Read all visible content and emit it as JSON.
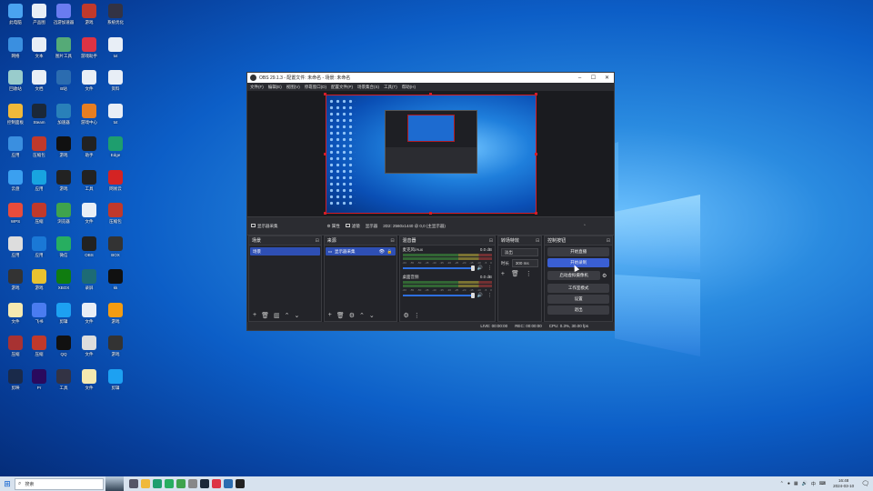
{
  "colors": {
    "accent": "#3a5fd3",
    "selection": "#2e4fb4",
    "preview_border": "#d31d28"
  },
  "desktop": {
    "icons": [
      {
        "label": "此电脑",
        "icon": "computer-icon",
        "color": "#4aa3f0"
      },
      {
        "label": "产品图",
        "icon": "document-icon",
        "color": "#e8eef6"
      },
      {
        "label": "迅游加速器",
        "icon": "app-icon",
        "color": "#6a7cf0"
      },
      {
        "label": "游戏",
        "icon": "winrar-icon",
        "color": "#c0392b"
      },
      {
        "label": "系统优化",
        "icon": "app-icon",
        "color": "#334"
      },
      {
        "label": "网络",
        "icon": "network-icon",
        "color": "#3a8fe0"
      },
      {
        "label": "文本",
        "icon": "document-icon",
        "color": "#e8eef6"
      },
      {
        "label": "图片工具",
        "icon": "app-icon",
        "color": "#5a7"
      },
      {
        "label": "游戏助手",
        "icon": "game-icon",
        "color": "#d34"
      },
      {
        "label": "txt",
        "icon": "document-icon",
        "color": "#e8eef6"
      },
      {
        "label": "回收站",
        "icon": "recycle-bin-icon",
        "color": "#9cc"
      },
      {
        "label": "文档",
        "icon": "document-icon",
        "color": "#e8eef6"
      },
      {
        "label": "B站",
        "icon": "bilibili-icon",
        "color": "#2b6cb0"
      },
      {
        "label": "文件",
        "icon": "document-icon",
        "color": "#e8eef6"
      },
      {
        "label": "资料",
        "icon": "document-icon",
        "color": "#e8eef6"
      },
      {
        "label": "控制面板",
        "icon": "folder-icon",
        "color": "#f0b93a"
      },
      {
        "label": "Steam",
        "icon": "steam-icon",
        "color": "#1b2838"
      },
      {
        "label": "加速器",
        "icon": "vpn-icon",
        "color": "#2980b9"
      },
      {
        "label": "游戏中心",
        "icon": "game-icon",
        "color": "#e67e22"
      },
      {
        "label": "txt",
        "icon": "document-icon",
        "color": "#e8eef6"
      },
      {
        "label": "应用",
        "icon": "app-icon",
        "color": "#3a8fe0"
      },
      {
        "label": "压缩包",
        "icon": "winrar-icon",
        "color": "#c0392b"
      },
      {
        "label": "游戏",
        "icon": "game-icon",
        "color": "#111"
      },
      {
        "label": "助手",
        "icon": "game-icon",
        "color": "#222"
      },
      {
        "label": "Edge",
        "icon": "edge-icon",
        "color": "#1e9e6e"
      },
      {
        "label": "云盘",
        "icon": "cloud-icon",
        "color": "#3ba0f0"
      },
      {
        "label": "应用",
        "icon": "app-icon",
        "color": "#18a4e0"
      },
      {
        "label": "游戏",
        "icon": "game-icon",
        "color": "#222"
      },
      {
        "label": "工具",
        "icon": "app-icon",
        "color": "#222"
      },
      {
        "label": "网易云",
        "icon": "music-icon",
        "color": "#d42323"
      },
      {
        "label": "WPS",
        "icon": "wps-icon",
        "color": "#e74c3c"
      },
      {
        "label": "压缩",
        "icon": "winrar-icon",
        "color": "#c0392b"
      },
      {
        "label": "浏览器",
        "icon": "browser-icon",
        "color": "#3fa34d"
      },
      {
        "label": "文件",
        "icon": "document-icon",
        "color": "#e8eef6"
      },
      {
        "label": "压缩包",
        "icon": "winrar-icon",
        "color": "#c0392b"
      },
      {
        "label": "应用",
        "icon": "app-icon",
        "color": "#ddd"
      },
      {
        "label": "应用",
        "icon": "app-icon",
        "color": "#1a78d6"
      },
      {
        "label": "微信",
        "icon": "wechat-icon",
        "color": "#27ae60"
      },
      {
        "label": "OBS",
        "icon": "obs-icon",
        "color": "#222"
      },
      {
        "label": "BOX",
        "icon": "app-icon",
        "color": "#333"
      },
      {
        "label": "游戏",
        "icon": "game-icon",
        "color": "#333"
      },
      {
        "label": "游戏",
        "icon": "game-icon",
        "color": "#e8c230"
      },
      {
        "label": "XBOX",
        "icon": "xbox-icon",
        "color": "#107c10"
      },
      {
        "label": "录屏",
        "icon": "app-icon",
        "color": "#1d6b75"
      },
      {
        "label": "kk",
        "icon": "app-icon",
        "color": "#111"
      },
      {
        "label": "文件",
        "icon": "document-icon",
        "color": "#f5e9b0"
      },
      {
        "label": "飞书",
        "icon": "app-icon",
        "color": "#4a7cf0"
      },
      {
        "label": "剪辑",
        "icon": "app-icon",
        "color": "#1da1f2"
      },
      {
        "label": "文件",
        "icon": "document-icon",
        "color": "#e8eef6"
      },
      {
        "label": "游戏",
        "icon": "game-icon",
        "color": "#f39c12"
      },
      {
        "label": "压缩",
        "icon": "winrar-icon",
        "color": "#a83232"
      },
      {
        "label": "压缩",
        "icon": "winrar-icon",
        "color": "#c0392b"
      },
      {
        "label": "QQ",
        "icon": "qq-icon",
        "color": "#111"
      },
      {
        "label": "文件",
        "icon": "document-icon",
        "color": "#ddd"
      },
      {
        "label": "游戏",
        "icon": "game-icon",
        "color": "#333"
      },
      {
        "label": "剪映",
        "icon": "app-icon",
        "color": "#1a2a4a"
      },
      {
        "label": "Pr",
        "icon": "premiere-icon",
        "color": "#2a0a5e"
      },
      {
        "label": "工具",
        "icon": "app-icon",
        "color": "#334"
      },
      {
        "label": "文件",
        "icon": "document-icon",
        "color": "#f5e9b0"
      },
      {
        "label": "剪辑",
        "icon": "app-icon",
        "color": "#1da1f2"
      }
    ]
  },
  "obs": {
    "title": "OBS 29.1.3 - 配置文件: 未命名 - 场景: 未命名",
    "menu": [
      "文件(F)",
      "编辑(E)",
      "视图(V)",
      "停靠窗口(D)",
      "配置文件(P)",
      "场景集合(S)",
      "工具(T)",
      "帮助(H)"
    ],
    "source_bar": {
      "source_name": "显示器采集",
      "properties": "属性",
      "filters": "滤镜",
      "display_label": "显示器",
      "display_value": "2D2: 2560x1440 @ 0,0 (主显示器)"
    },
    "scenes": {
      "title": "场景",
      "items": [
        "场景"
      ]
    },
    "sources": {
      "title": "来源",
      "items": [
        "显示器采集"
      ]
    },
    "mixer": {
      "title": "混音器",
      "tracks": [
        {
          "name": "麦克风/Aux",
          "db": "0.0 dB"
        },
        {
          "name": "桌面音频",
          "db": "0.0 dB"
        }
      ],
      "scale": [
        "-60",
        "-55",
        "-50",
        "-45",
        "-40",
        "-35",
        "-30",
        "-25",
        "-20",
        "-15",
        "-10",
        "-5",
        "0"
      ]
    },
    "transitions": {
      "title": "转场特效",
      "selected": "淡出",
      "duration_label": "时长",
      "duration": "300 ms"
    },
    "controls": {
      "title": "控制按钮",
      "start_stream": "开始直播",
      "start_record": "开始录制",
      "virtual_cam": "启动虚拟摄像机",
      "studio_mode": "工作室模式",
      "settings": "设置",
      "exit": "退出"
    },
    "status": {
      "live": "LIVE: 00:00:00",
      "rec": "REC: 00:00:00",
      "cpu": "CPU: 0.3%, 30.00 fps"
    }
  },
  "taskbar": {
    "search_placeholder": "搜索",
    "time": "16:48",
    "date": "2024-03-10",
    "ime": "中",
    "apps": [
      {
        "icon": "task-view-icon",
        "color": "#556"
      },
      {
        "icon": "explorer-icon",
        "color": "#f0b93a"
      },
      {
        "icon": "edge-icon",
        "color": "#1e9e6e"
      },
      {
        "icon": "wechat-icon",
        "color": "#27ae60"
      },
      {
        "icon": "browser-icon",
        "color": "#3fa34d"
      },
      {
        "icon": "app-icon",
        "color": "#888"
      },
      {
        "icon": "steam-icon",
        "color": "#1b2838"
      },
      {
        "icon": "app-icon",
        "color": "#d34"
      },
      {
        "icon": "app-icon",
        "color": "#2b6cb0"
      },
      {
        "icon": "obs-icon",
        "color": "#222"
      }
    ]
  }
}
